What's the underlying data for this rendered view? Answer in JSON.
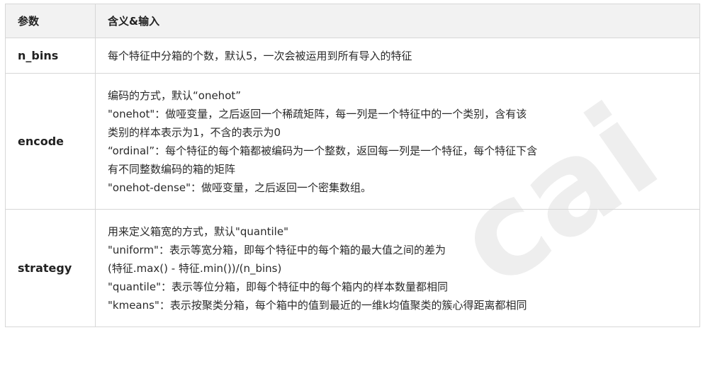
{
  "watermark": "cai",
  "table": {
    "headers": [
      "参数",
      "含义&输入"
    ],
    "rows": [
      {
        "name": "n_bins",
        "lines": [
          "每个特征中分箱的个数，默认5，一次会被运用到所有导入的特征"
        ]
      },
      {
        "name": "encode",
        "lines": [
          "编码的方式，默认“onehot”",
          "\"onehot\"：做哑变量，之后返回一个稀疏矩阵，每一列是一个特征中的一个类别，含有该",
          "类别的样本表示为1，不含的表示为0",
          "“ordinal”：每个特征的每个箱都被编码为一个整数，返回每一列是一个特征，每个特征下含",
          "有不同整数编码的箱的矩阵",
          "\"onehot-dense\"：做哑变量，之后返回一个密集数组。"
        ]
      },
      {
        "name": "strategy",
        "lines": [
          "用来定义箱宽的方式，默认\"quantile\"",
          "\"uniform\"：表示等宽分箱，即每个特征中的每个箱的最大值之间的差为",
          "(特征.max() - 特征.min())/(n_bins)",
          "\"quantile\"：表示等位分箱，即每个特征中的每个箱内的样本数量都相同",
          "\"kmeans\"：表示按聚类分箱，每个箱中的值到最近的一维k均值聚类的簇心得距离都相同"
        ]
      }
    ]
  }
}
